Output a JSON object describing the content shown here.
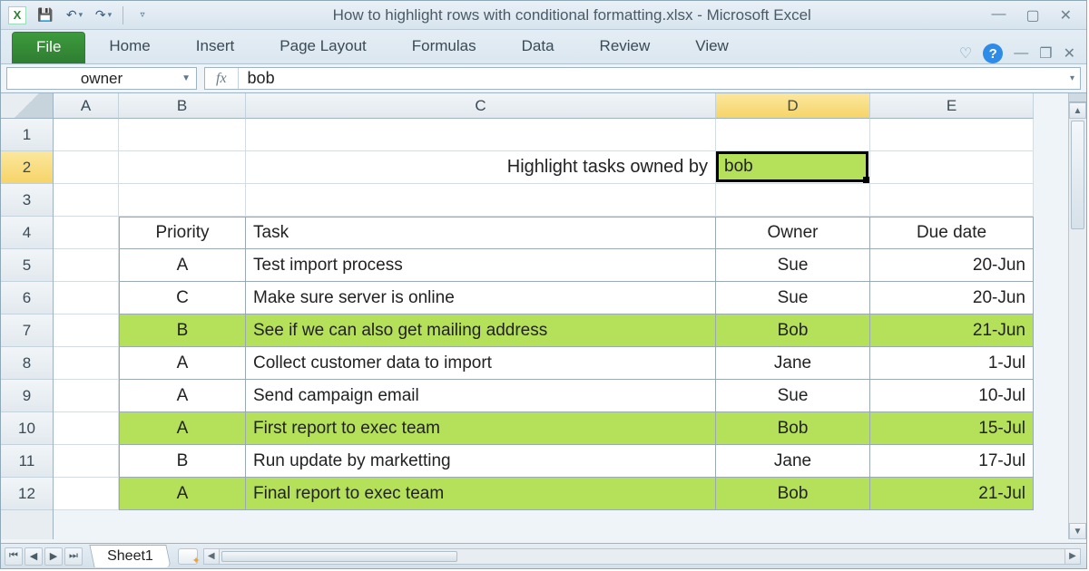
{
  "window": {
    "title": "How to highlight rows with conditional formatting.xlsx - Microsoft Excel",
    "app_letter": "X"
  },
  "ribbon": {
    "file": "File",
    "tabs": [
      "Home",
      "Insert",
      "Page Layout",
      "Formulas",
      "Data",
      "Review",
      "View"
    ]
  },
  "formula_bar": {
    "name_box": "owner",
    "fx_label": "fx",
    "value": "bob"
  },
  "columns": [
    "A",
    "B",
    "C",
    "D",
    "E"
  ],
  "row_numbers": [
    "1",
    "2",
    "3",
    "4",
    "5",
    "6",
    "7",
    "8",
    "9",
    "10",
    "11",
    "12"
  ],
  "active_col": "D",
  "active_row": "2",
  "prompt": {
    "text": "Highlight tasks owned by",
    "value": "bob"
  },
  "table": {
    "headers": {
      "priority": "Priority",
      "task": "Task",
      "owner": "Owner",
      "due": "Due date"
    },
    "rows": [
      {
        "p": "A",
        "t": "Test import process",
        "o": "Sue",
        "d": "20-Jun",
        "hl": false
      },
      {
        "p": "C",
        "t": "Make sure server is online",
        "o": "Sue",
        "d": "20-Jun",
        "hl": false
      },
      {
        "p": "B",
        "t": "See if we can also get mailing address",
        "o": "Bob",
        "d": "21-Jun",
        "hl": true
      },
      {
        "p": "A",
        "t": "Collect customer data to import",
        "o": "Jane",
        "d": "1-Jul",
        "hl": false
      },
      {
        "p": "A",
        "t": "Send campaign email",
        "o": "Sue",
        "d": "10-Jul",
        "hl": false
      },
      {
        "p": "A",
        "t": "First report to exec team",
        "o": "Bob",
        "d": "15-Jul",
        "hl": true
      },
      {
        "p": "B",
        "t": "Run update by marketting",
        "o": "Jane",
        "d": "17-Jul",
        "hl": false
      },
      {
        "p": "A",
        "t": "Final report to exec team",
        "o": "Bob",
        "d": "21-Jul",
        "hl": true
      }
    ]
  },
  "sheet_tab": "Sheet1"
}
